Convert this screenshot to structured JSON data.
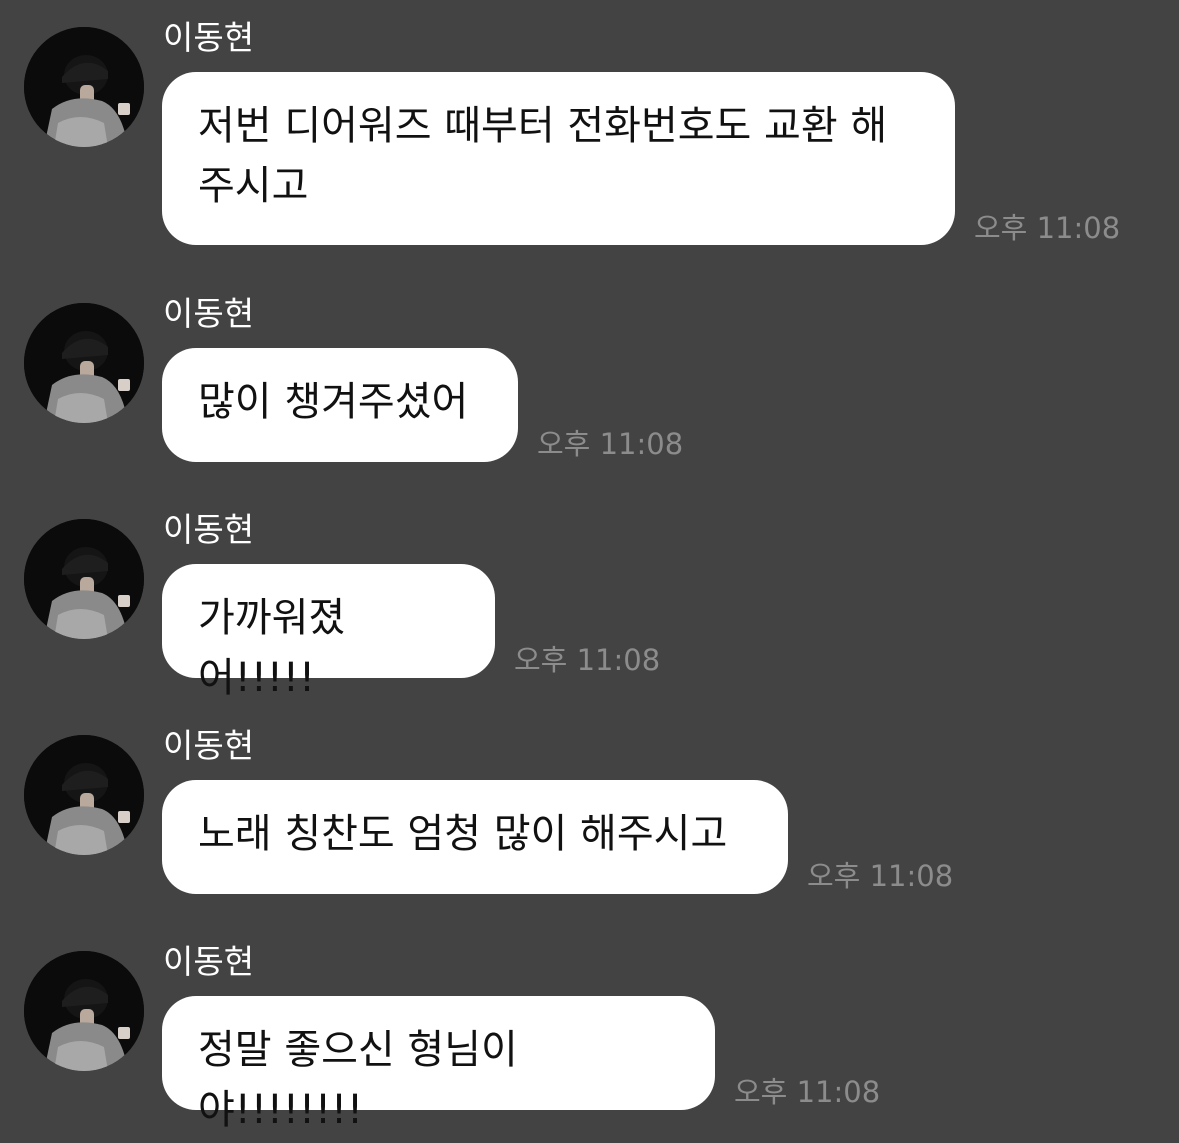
{
  "chat": {
    "messages": [
      {
        "sender": "이동현",
        "text": "저번 디어워즈 때부터 전화번호도 교환 해\n주시고",
        "time": "오후 11:08",
        "avatar_icon": "profile-photo-icon"
      },
      {
        "sender": "이동현",
        "text": "많이 챙겨주셨어",
        "time": "오후 11:08",
        "avatar_icon": "profile-photo-icon"
      },
      {
        "sender": "이동현",
        "text": "가까워졌어!!!!!",
        "time": "오후 11:08",
        "avatar_icon": "profile-photo-icon"
      },
      {
        "sender": "이동현",
        "text": "노래 칭찬도 엄청 많이 해주시고",
        "time": "오후 11:08",
        "avatar_icon": "profile-photo-icon"
      },
      {
        "sender": "이동현",
        "text": "정말 좋으신 형님이야!!!!!!!!",
        "time": "오후 11:08",
        "avatar_icon": "profile-photo-icon"
      }
    ]
  },
  "colors": {
    "background": "#434343",
    "bubble": "#ffffff",
    "sender_text": "#ffffff",
    "time_text": "#8c8c8c"
  }
}
